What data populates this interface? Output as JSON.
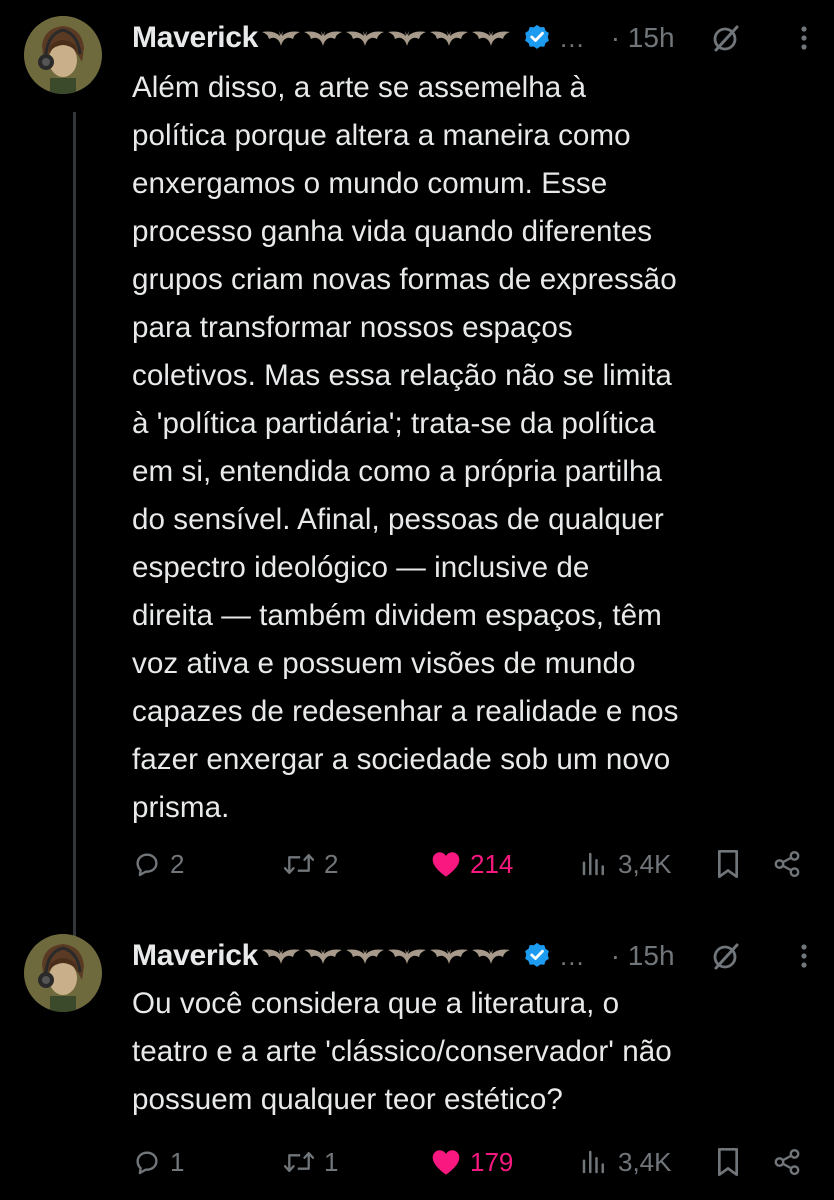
{
  "tweets": [
    {
      "author": {
        "name": "Maverick",
        "bat_count": 6,
        "verified": true,
        "verified_color": "#1d9bf0"
      },
      "ellipsis": "...",
      "time": "· 15h",
      "text_lines": [
        "Além disso, a arte se assemelha à",
        "política porque altera a maneira como",
        "enxergamos o mundo comum. Esse",
        "processo ganha vida quando diferentes",
        "grupos criam novas formas de expressão",
        "para transformar nossos espaços",
        "coletivos. Mas essa relação não se limita",
        "à 'política partidária'; trata-se da política",
        "em si, entendida como a própria partilha",
        "do sensível. Afinal, pessoas de qualquer",
        "espectro ideológico — inclusive de",
        "direita — também dividem espaços, têm",
        "voz ativa e possuem visões de mundo",
        "capazes de redesenhar a realidade e nos",
        "fazer enxergar a sociedade sob um novo",
        "prisma."
      ],
      "actions": {
        "replies": "2",
        "reposts": "2",
        "likes": "214",
        "liked": true,
        "views": "3,4K"
      }
    },
    {
      "author": {
        "name": "Maverick",
        "bat_count": 6,
        "verified": true,
        "verified_color": "#1d9bf0"
      },
      "ellipsis": "...",
      "time": "· 15h",
      "text_lines": [
        "Ou você considera que a literatura, o",
        "teatro e a arte 'clássico/conservador' não",
        "possuem qualquer teor estético?"
      ],
      "actions": {
        "replies": "1",
        "reposts": "1",
        "likes": "179",
        "liked": true,
        "views": "3,4K"
      }
    }
  ],
  "icons": {
    "reply": "reply-icon",
    "repost": "repost-icon",
    "like": "heart-icon",
    "views": "views-icon",
    "bookmark": "bookmark-icon",
    "share": "share-icon",
    "grok": "grok-icon",
    "more": "more-icon"
  },
  "colors": {
    "background": "#000000",
    "text": "#e7e9ea",
    "muted": "#71767b",
    "like": "#f91880",
    "verified": "#1d9bf0",
    "thread_line": "#333639"
  }
}
